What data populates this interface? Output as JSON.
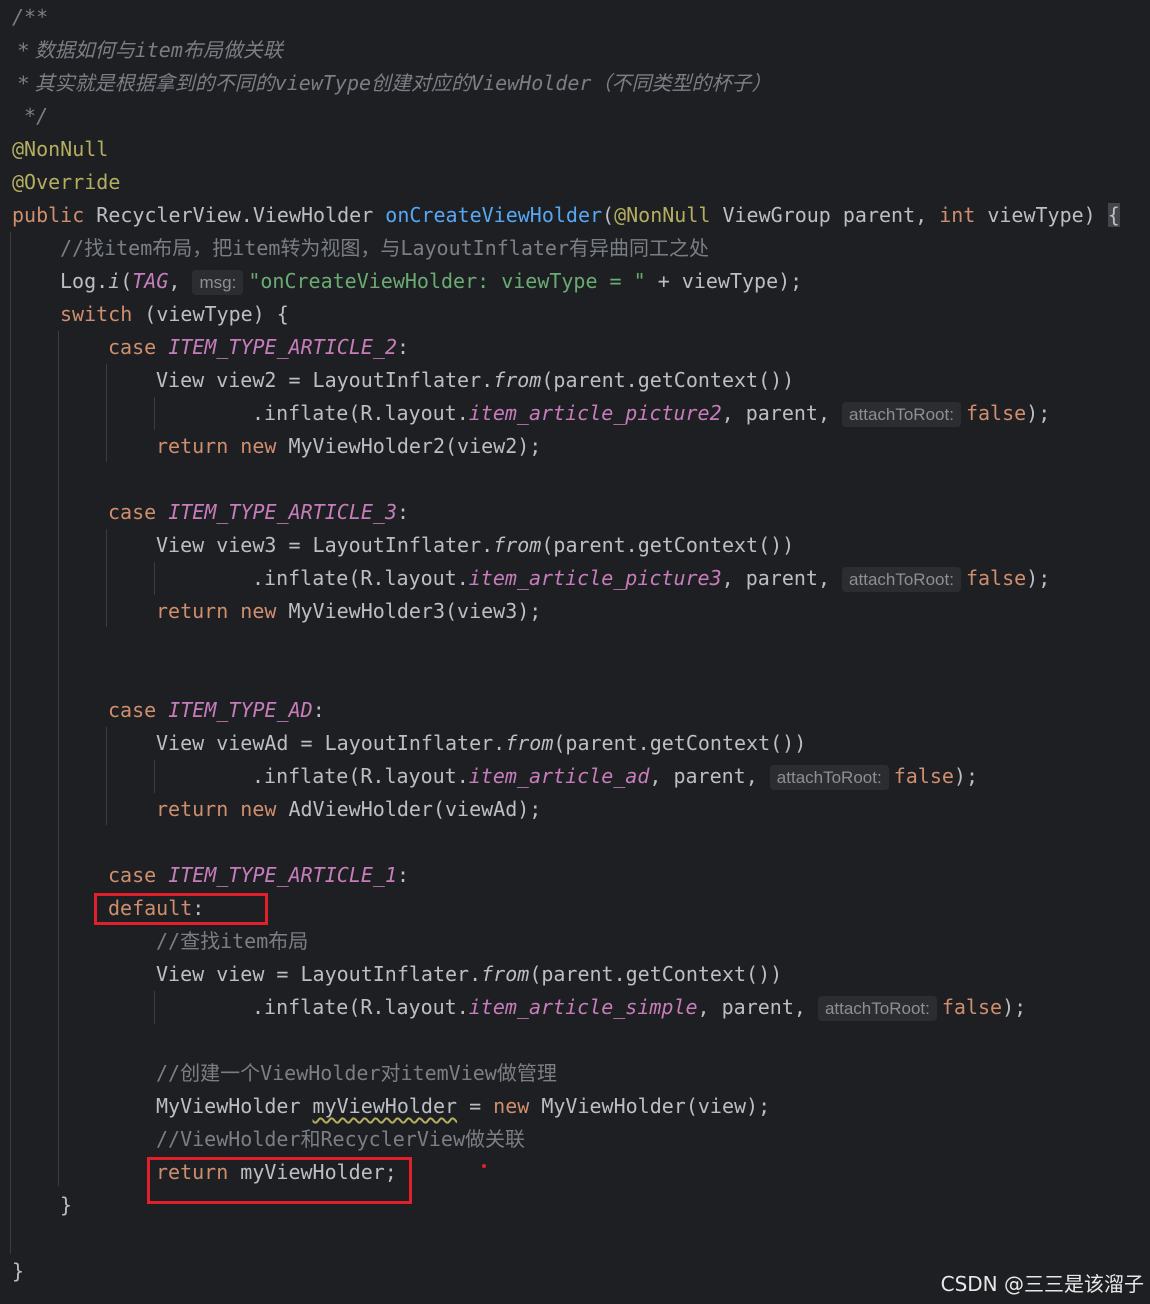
{
  "doc": {
    "l1": "/**",
    "l2_a": " * 数据如何与",
    "l2_b": "item",
    "l2_c": "布局做关联",
    "l3_a": " * 其实就是根据拿到的不同的",
    "l3_b": "viewType",
    "l3_c": "创建对应的",
    "l3_d": "ViewHolder",
    "l3_e": "（不同类型的杯子）",
    "l4": " */"
  },
  "annotations": {
    "nonnull": "@NonNull",
    "override": "@Override"
  },
  "signature": {
    "public": "public",
    "type1": " RecyclerView.ViewHolder ",
    "name": "onCreateViewHolder",
    "open": "(",
    "nonnull": "@NonNull",
    "param1": " ViewGroup parent, ",
    "int": "int",
    "param2": " viewType) ",
    "brace": "{"
  },
  "body": {
    "c1_a": "//找",
    "c1_b": "item",
    "c1_c": "布局，把",
    "c1_d": "item",
    "c1_e": "转为视图，与",
    "c1_f": "LayoutInflater",
    "c1_g": "有异曲同工之处",
    "log_a": "Log.",
    "log_i": "i",
    "log_b": "(",
    "log_tag": "TAG",
    "log_c": ", ",
    "log_hint": "msg:",
    "log_str": "\"onCreateViewHolder: viewType = \"",
    "log_d": " + viewType);",
    "switch_kw": "switch",
    "switch_rest": " (viewType) {",
    "close_switch": "}",
    "close_method": "}"
  },
  "words": {
    "case": "case",
    "colon": ":",
    "view": "View ",
    "eq_inflater": " = LayoutInflater.",
    "from": "from",
    "get_context": "(parent.getContext())",
    "inflate": ".inflate(R.layout.",
    "parent": ", parent, ",
    "hint": "attachToRoot:",
    "false": "false",
    "end": ");",
    "return": "return",
    "new": "new"
  },
  "cases": [
    {
      "const": "ITEM_TYPE_ARTICLE_2",
      "var": "view2",
      "layout": "item_article_picture2",
      "holder": " MyViewHolder2(view2);"
    },
    {
      "const": "ITEM_TYPE_ARTICLE_3",
      "var": "view3",
      "layout": "item_article_picture3",
      "holder": " MyViewHolder3(view3);"
    },
    {
      "const": "ITEM_TYPE_AD",
      "var": "viewAd",
      "layout": "item_article_ad",
      "holder": " AdViewHolder(viewAd);"
    },
    {
      "const": "ITEM_TYPE_ARTICLE_1"
    }
  ],
  "default_block": {
    "default_kw": "default",
    "c2_a": "//查找",
    "c2_b": "item",
    "c2_c": "布局",
    "view_var": "view",
    "layout": "item_article_simple",
    "c3_a": "//创建一个",
    "c3_b": "ViewHolder",
    "c3_c": "对",
    "c3_d": "itemView",
    "c3_e": "做管理",
    "holder_type": "MyViewHolder ",
    "holder_var": "myViewHolder",
    "holder_eq": " = ",
    "holder_new": " MyViewHolder(view);",
    "c4_a": "//ViewHolder",
    "c4_b": "和",
    "c4_c": "RecyclerView",
    "c4_d": "做关联",
    "ret_var": " myViewHolder;"
  },
  "watermark": "CSDN @三三是该溜子",
  "colors": {
    "background": "#1e1f22",
    "keyword": "#cf8e6d",
    "function": "#56a8f5",
    "string": "#6aab73",
    "constant": "#c77dbb",
    "annotation": "#b3ae60",
    "comment": "#7a7e85",
    "highlight_box": "#e0202a"
  }
}
